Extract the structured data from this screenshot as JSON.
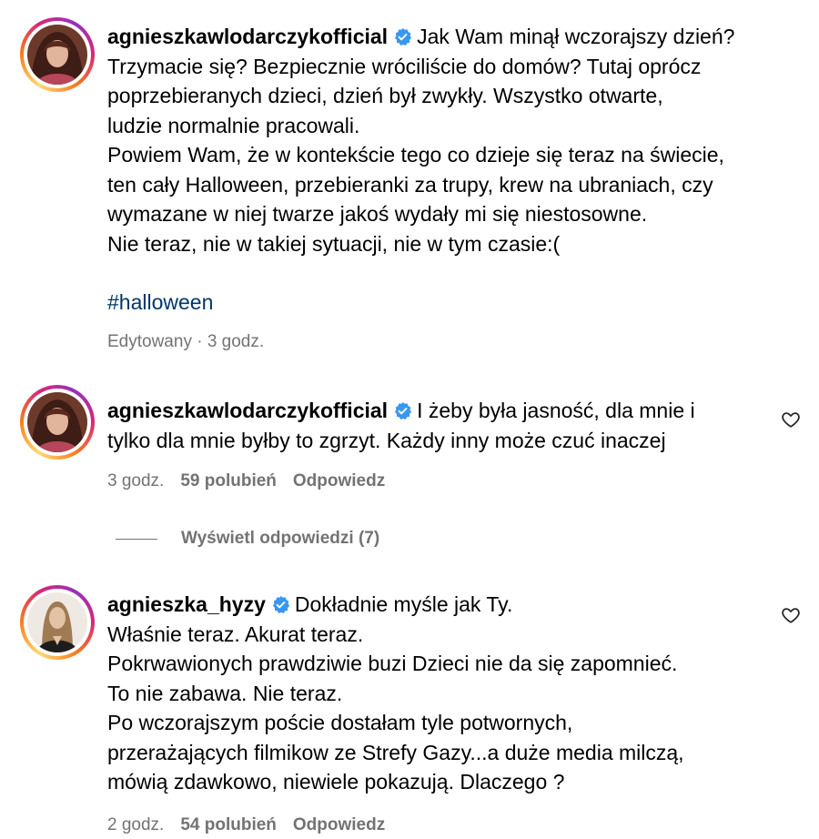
{
  "verified_color": "#3897f0",
  "comments": [
    {
      "username": "agnieszkawlodarczykofficial",
      "first_line_text": "Jak Wam minął wczorajszy dzień?",
      "lines": [
        "Trzymacie się? Bezpiecznie wróciliście do domów? Tutaj oprócz",
        "poprzebieranych dzieci, dzień był zwykły. Wszystko otwarte,",
        "ludzie normalnie pracowali.",
        "Powiem Wam, że w kontekście tego co dzieje się teraz na świecie,",
        "ten cały Halloween, przebieranki za trupy, krew na ubraniach, czy",
        "wymazane w niej twarze jakoś wydały mi się niestosowne.",
        "Nie teraz, nie w takiej sytuacji, nie w tym czasie:("
      ],
      "hashtag": "#halloween",
      "meta": "Edytowany · 3 godz."
    },
    {
      "username": "agnieszkawlodarczykofficial",
      "first_line_text": "I żeby była jasność, dla mnie i",
      "lines": [
        "tylko dla mnie byłby to zgrzyt. Każdy inny może czuć inaczej"
      ],
      "time": "3 godz.",
      "likes": "59 polubień",
      "reply": "Odpowiedz",
      "view_replies": "Wyświetl odpowiedzi (7)"
    },
    {
      "username": "agnieszka_hyzy",
      "first_line_text": "Dokładnie myśle jak Ty.",
      "lines": [
        "Właśnie teraz. Akurat teraz.",
        "Pokrwawionych prawdziwie buzi Dzieci nie da się zapomnieć.",
        "To nie zabawa. Nie teraz.",
        "Po wczorajszym poście dostałam tyle potwornych,",
        "przerażających filmikow ze Strefy Gazy...a duże media milczą,",
        "mówią zdawkowo, niewiele pokazują. Dlaczego ?"
      ],
      "time": "2 godz.",
      "likes": "54 polubień",
      "reply": "Odpowiedz"
    }
  ]
}
